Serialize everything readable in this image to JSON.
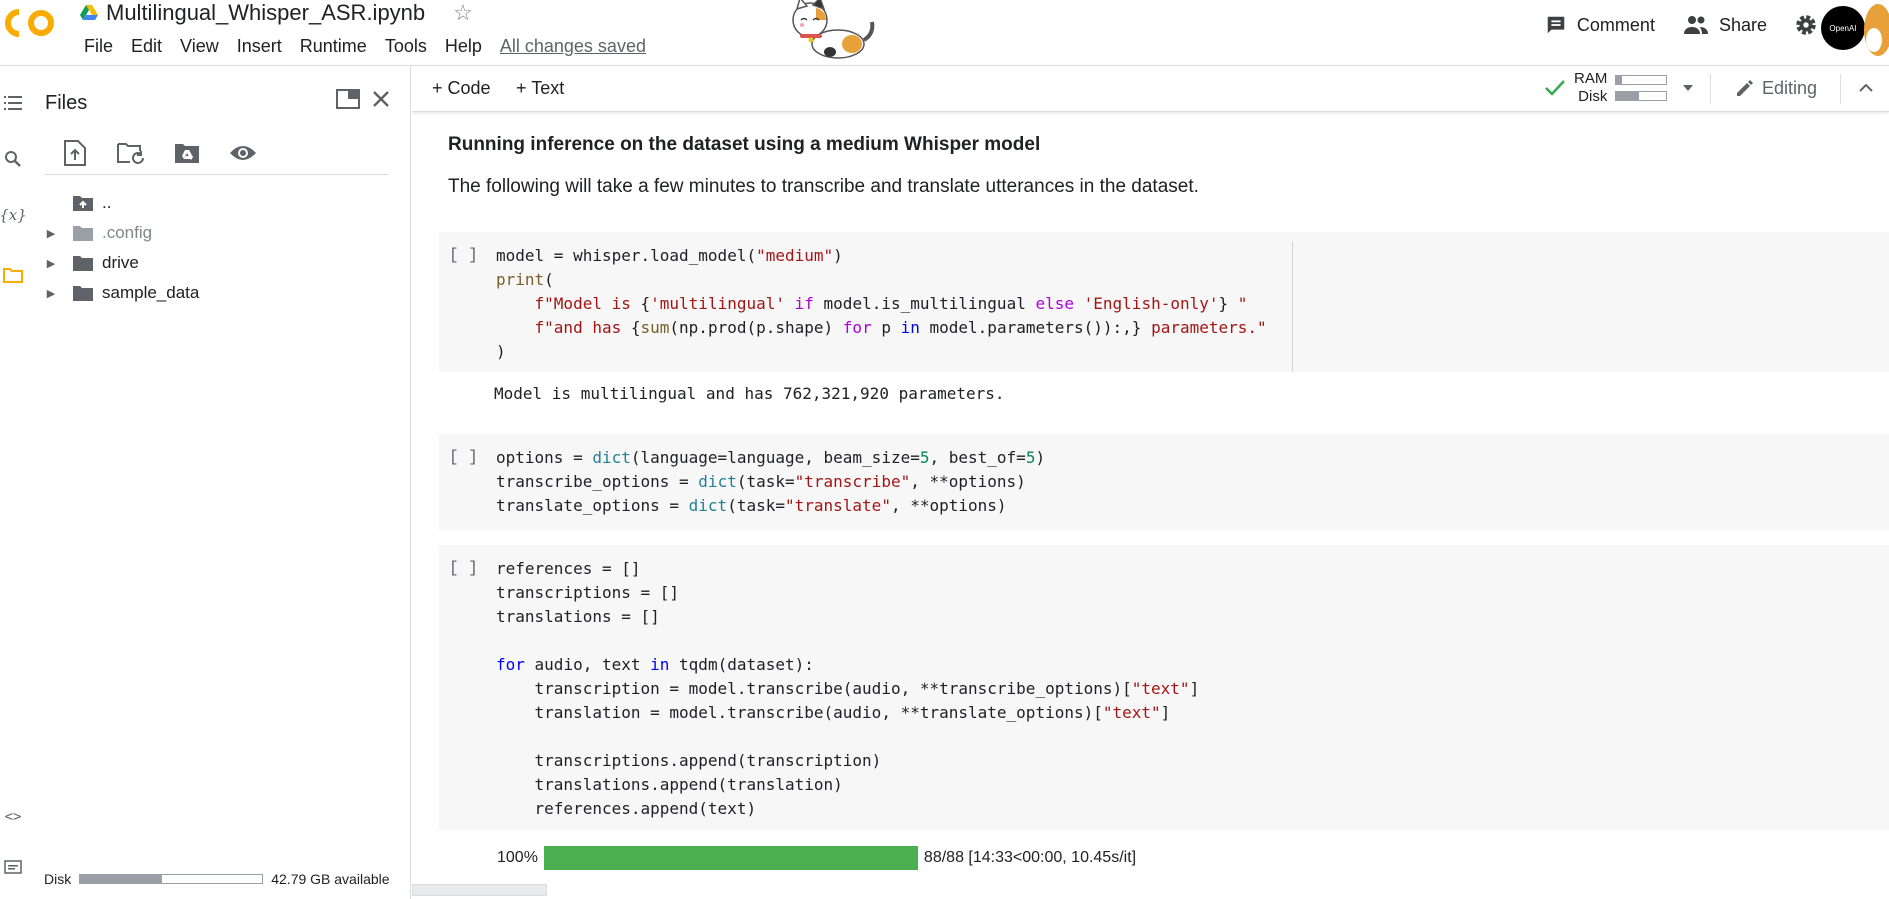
{
  "header": {
    "notebook_title": "Multilingual_Whisper_ASR.ipynb",
    "menu": [
      "File",
      "Edit",
      "View",
      "Insert",
      "Runtime",
      "Tools",
      "Help"
    ],
    "saved_status": "All changes saved",
    "comment_label": "Comment",
    "share_label": "Share",
    "avatar_text": "OpenAI"
  },
  "files_panel": {
    "title": "Files",
    "tree": [
      {
        "name": "..",
        "type": "parent"
      },
      {
        "name": ".config",
        "type": "folder"
      },
      {
        "name": "drive",
        "type": "folder"
      },
      {
        "name": "sample_data",
        "type": "folder"
      }
    ],
    "disk_label": "Disk",
    "disk_available": "42.79 GB available",
    "disk_used_fraction": 0.45
  },
  "toolbar": {
    "add_code": "+ Code",
    "add_text": "+ Text",
    "ram_label": "RAM",
    "disk_label": "Disk",
    "ram_used_fraction": 0.12,
    "disk_used_fraction": 0.45,
    "editing_label": "Editing"
  },
  "notebook": {
    "heading": "Running inference on the dataset using a medium Whisper model",
    "paragraph": "The following will take a few minutes to transcribe and translate utterances in the dataset.",
    "run_marker": "[ ]",
    "cell1_output": "Model is multilingual and has 762,321,920 parameters.",
    "progress_percent_label": "100%",
    "progress_fraction": 1.0,
    "progress_stats": "88/88 [14:33<00:00, 10.45s/it]"
  },
  "colors": {
    "accent_orange": "#f9ab00",
    "progress_green": "#4caf50",
    "check_green": "#34a853"
  }
}
